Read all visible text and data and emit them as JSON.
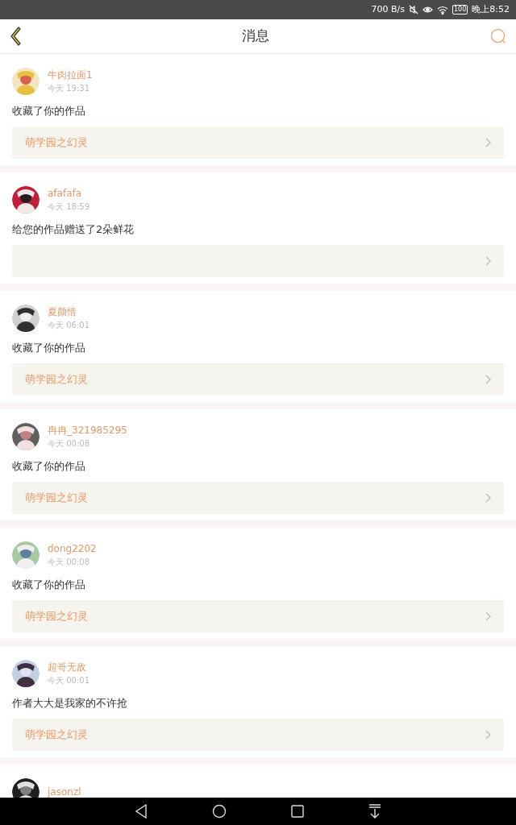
{
  "status_bar": {
    "speed": "700 B/s",
    "battery": "100",
    "time": "晚上8:52"
  },
  "header": {
    "title": "消息"
  },
  "messages": [
    {
      "user": "牛肉拉面1",
      "time": "今天 19:31",
      "text": "收藏了你的作品",
      "work": "萌学园之幻灵"
    },
    {
      "user": "afafafa",
      "time": "今天 18:59",
      "text": "给您的作品赠送了2朵鲜花"
    },
    {
      "user": "夏颜惜",
      "time": "今天 06:01",
      "text": "收藏了你的作品",
      "work": "萌学园之幻灵"
    },
    {
      "user": "冉冉_321985295",
      "time": "今天 00:08",
      "text": "收藏了你的作品",
      "work": "萌学园之幻灵"
    },
    {
      "user": "dong2202",
      "time": "今天 00:08",
      "text": "收藏了你的作品",
      "work": "萌学园之幻灵"
    },
    {
      "user": "超哥无敌",
      "time": "今天 00:01",
      "text": "作者大大是我家的不许抢",
      "work": "萌学园之幻灵"
    },
    {
      "user": "jasonzl"
    }
  ]
}
